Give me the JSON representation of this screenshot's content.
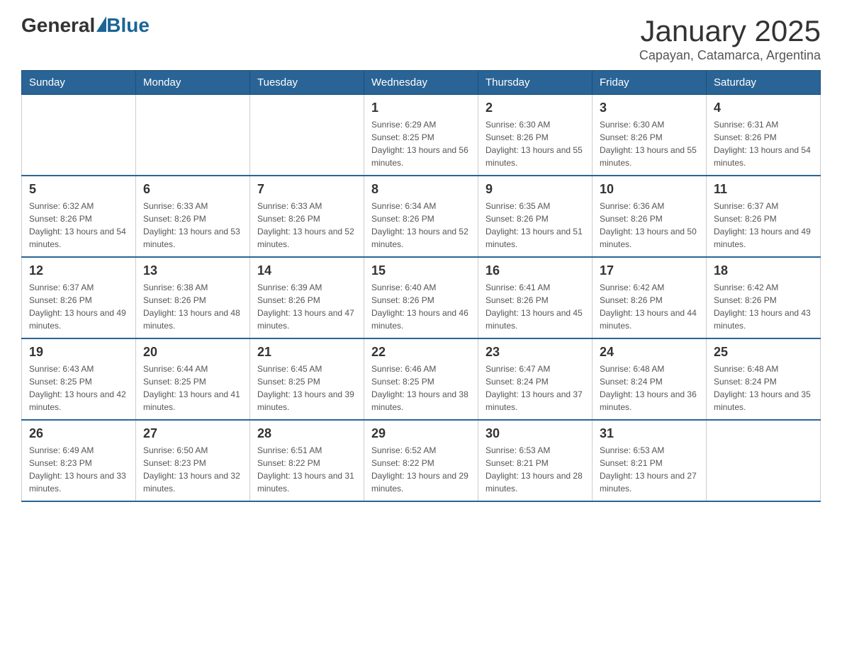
{
  "logo": {
    "general": "General",
    "blue": "Blue"
  },
  "title": "January 2025",
  "subtitle": "Capayan, Catamarca, Argentina",
  "days_of_week": [
    "Sunday",
    "Monday",
    "Tuesday",
    "Wednesday",
    "Thursday",
    "Friday",
    "Saturday"
  ],
  "weeks": [
    [
      {
        "day": "",
        "detail": ""
      },
      {
        "day": "",
        "detail": ""
      },
      {
        "day": "",
        "detail": ""
      },
      {
        "day": "1",
        "detail": "Sunrise: 6:29 AM\nSunset: 8:25 PM\nDaylight: 13 hours and 56 minutes."
      },
      {
        "day": "2",
        "detail": "Sunrise: 6:30 AM\nSunset: 8:26 PM\nDaylight: 13 hours and 55 minutes."
      },
      {
        "day": "3",
        "detail": "Sunrise: 6:30 AM\nSunset: 8:26 PM\nDaylight: 13 hours and 55 minutes."
      },
      {
        "day": "4",
        "detail": "Sunrise: 6:31 AM\nSunset: 8:26 PM\nDaylight: 13 hours and 54 minutes."
      }
    ],
    [
      {
        "day": "5",
        "detail": "Sunrise: 6:32 AM\nSunset: 8:26 PM\nDaylight: 13 hours and 54 minutes."
      },
      {
        "day": "6",
        "detail": "Sunrise: 6:33 AM\nSunset: 8:26 PM\nDaylight: 13 hours and 53 minutes."
      },
      {
        "day": "7",
        "detail": "Sunrise: 6:33 AM\nSunset: 8:26 PM\nDaylight: 13 hours and 52 minutes."
      },
      {
        "day": "8",
        "detail": "Sunrise: 6:34 AM\nSunset: 8:26 PM\nDaylight: 13 hours and 52 minutes."
      },
      {
        "day": "9",
        "detail": "Sunrise: 6:35 AM\nSunset: 8:26 PM\nDaylight: 13 hours and 51 minutes."
      },
      {
        "day": "10",
        "detail": "Sunrise: 6:36 AM\nSunset: 8:26 PM\nDaylight: 13 hours and 50 minutes."
      },
      {
        "day": "11",
        "detail": "Sunrise: 6:37 AM\nSunset: 8:26 PM\nDaylight: 13 hours and 49 minutes."
      }
    ],
    [
      {
        "day": "12",
        "detail": "Sunrise: 6:37 AM\nSunset: 8:26 PM\nDaylight: 13 hours and 49 minutes."
      },
      {
        "day": "13",
        "detail": "Sunrise: 6:38 AM\nSunset: 8:26 PM\nDaylight: 13 hours and 48 minutes."
      },
      {
        "day": "14",
        "detail": "Sunrise: 6:39 AM\nSunset: 8:26 PM\nDaylight: 13 hours and 47 minutes."
      },
      {
        "day": "15",
        "detail": "Sunrise: 6:40 AM\nSunset: 8:26 PM\nDaylight: 13 hours and 46 minutes."
      },
      {
        "day": "16",
        "detail": "Sunrise: 6:41 AM\nSunset: 8:26 PM\nDaylight: 13 hours and 45 minutes."
      },
      {
        "day": "17",
        "detail": "Sunrise: 6:42 AM\nSunset: 8:26 PM\nDaylight: 13 hours and 44 minutes."
      },
      {
        "day": "18",
        "detail": "Sunrise: 6:42 AM\nSunset: 8:26 PM\nDaylight: 13 hours and 43 minutes."
      }
    ],
    [
      {
        "day": "19",
        "detail": "Sunrise: 6:43 AM\nSunset: 8:25 PM\nDaylight: 13 hours and 42 minutes."
      },
      {
        "day": "20",
        "detail": "Sunrise: 6:44 AM\nSunset: 8:25 PM\nDaylight: 13 hours and 41 minutes."
      },
      {
        "day": "21",
        "detail": "Sunrise: 6:45 AM\nSunset: 8:25 PM\nDaylight: 13 hours and 39 minutes."
      },
      {
        "day": "22",
        "detail": "Sunrise: 6:46 AM\nSunset: 8:25 PM\nDaylight: 13 hours and 38 minutes."
      },
      {
        "day": "23",
        "detail": "Sunrise: 6:47 AM\nSunset: 8:24 PM\nDaylight: 13 hours and 37 minutes."
      },
      {
        "day": "24",
        "detail": "Sunrise: 6:48 AM\nSunset: 8:24 PM\nDaylight: 13 hours and 36 minutes."
      },
      {
        "day": "25",
        "detail": "Sunrise: 6:48 AM\nSunset: 8:24 PM\nDaylight: 13 hours and 35 minutes."
      }
    ],
    [
      {
        "day": "26",
        "detail": "Sunrise: 6:49 AM\nSunset: 8:23 PM\nDaylight: 13 hours and 33 minutes."
      },
      {
        "day": "27",
        "detail": "Sunrise: 6:50 AM\nSunset: 8:23 PM\nDaylight: 13 hours and 32 minutes."
      },
      {
        "day": "28",
        "detail": "Sunrise: 6:51 AM\nSunset: 8:22 PM\nDaylight: 13 hours and 31 minutes."
      },
      {
        "day": "29",
        "detail": "Sunrise: 6:52 AM\nSunset: 8:22 PM\nDaylight: 13 hours and 29 minutes."
      },
      {
        "day": "30",
        "detail": "Sunrise: 6:53 AM\nSunset: 8:21 PM\nDaylight: 13 hours and 28 minutes."
      },
      {
        "day": "31",
        "detail": "Sunrise: 6:53 AM\nSunset: 8:21 PM\nDaylight: 13 hours and 27 minutes."
      },
      {
        "day": "",
        "detail": ""
      }
    ]
  ]
}
